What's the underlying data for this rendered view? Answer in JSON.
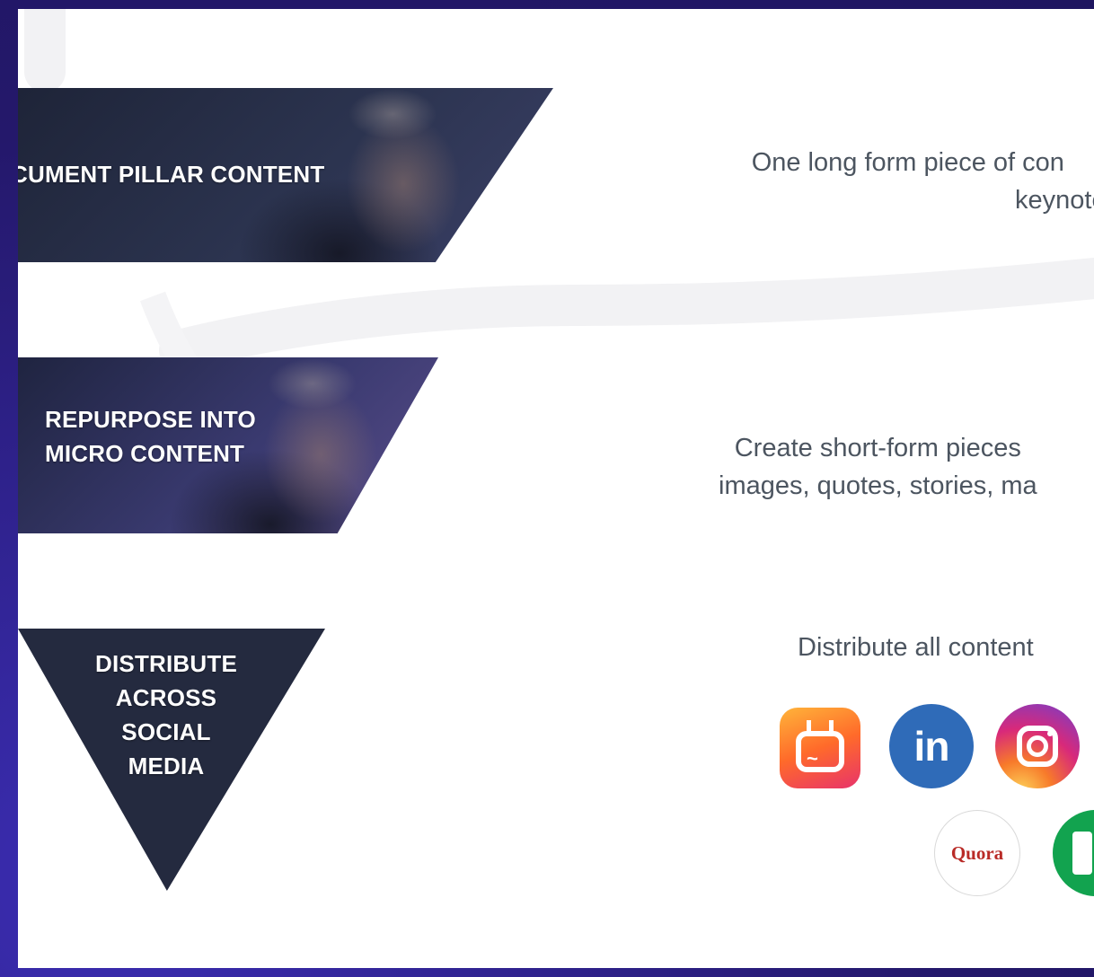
{
  "funnel": {
    "tier1_label": "CUMENT PILLAR CONTENT",
    "tier2_label_line1": "REPURPOSE INTO",
    "tier2_label_line2": "MICRO CONTENT",
    "tier3_label_lines": [
      "DISTRIBUTE",
      "ACROSS",
      "SOCIAL",
      "MEDIA"
    ]
  },
  "descriptions": {
    "tier1_line1": "One long form piece of con",
    "tier1_line2": "keynote",
    "tier2_line1": "Create short-form pieces",
    "tier2_line2": "images, quotes, stories, ma",
    "tier3_line1": "Distribute all content"
  },
  "platforms": {
    "igtv": "igtv-icon",
    "linkedin": "linkedin-icon",
    "linkedin_text": "in",
    "instagram": "instagram-icon",
    "quora": "quora-icon",
    "quora_text": "Quora",
    "medium": "medium-icon"
  },
  "colors": {
    "frame": "#2a1f7a",
    "slide": "#ffffff",
    "tier_dark": "#242a3f",
    "text_gray": "#4c5560",
    "linkedin": "#2f6bb8",
    "quora": "#b92b27",
    "medium": "#12a34f"
  }
}
